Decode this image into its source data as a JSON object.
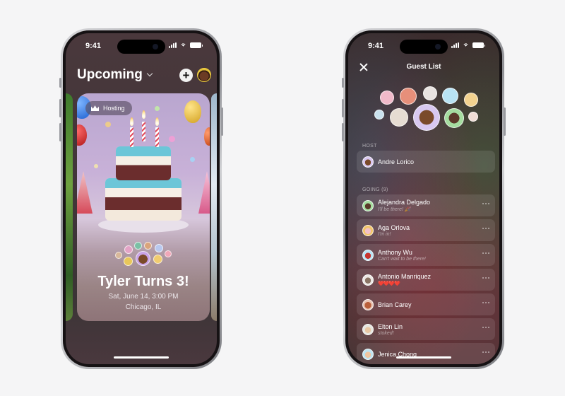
{
  "left_phone": {
    "status": {
      "time": "9:41"
    },
    "header": {
      "title": "Upcoming",
      "add_icon": "plus-icon",
      "profile_icon": "avatar"
    },
    "event_card": {
      "badge": "Hosting",
      "badge_icon": "crown-icon",
      "title": "Tyler Turns 3!",
      "date": "Sat, June 14, 3:00 PM",
      "location": "Chicago, IL"
    }
  },
  "right_phone": {
    "status": {
      "time": "9:41"
    },
    "header": {
      "title": "Guest List",
      "close_icon": "close-icon"
    },
    "host_section": {
      "label": "HOST",
      "host": {
        "name": "Andre Lorico"
      }
    },
    "going_section": {
      "label": "GOING (9)",
      "guests": [
        {
          "name": "Alejandra Delgado",
          "note": "I'll be there! 🎉"
        },
        {
          "name": "Aga Orlova",
          "note": "I'm in!"
        },
        {
          "name": "Anthony Wu",
          "note": "Can't wait to be there!"
        },
        {
          "name": "Antonio Manriquez",
          "note": "❤️❤️❤️❤️"
        },
        {
          "name": "Brian Carey",
          "note": ""
        },
        {
          "name": "Elton Lin",
          "note": "stoked!"
        },
        {
          "name": "Jenica Chong",
          "note": ""
        }
      ]
    }
  },
  "colors": {
    "background": "#f5f5f6",
    "accent_teal": "#6cc6d8",
    "heart_red": "#e0303a"
  }
}
